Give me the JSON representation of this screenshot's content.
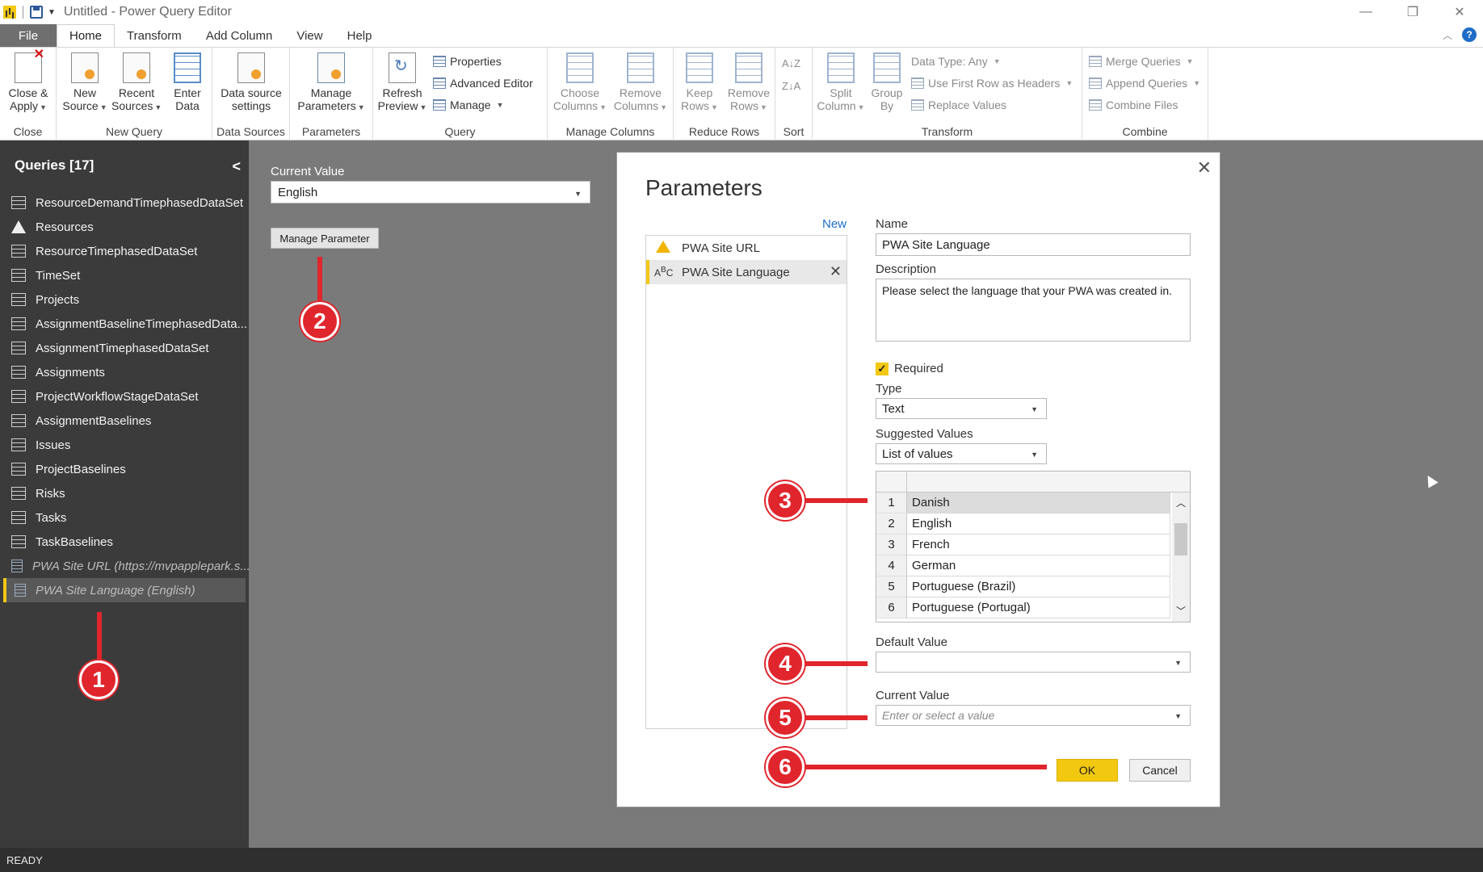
{
  "window": {
    "title": "Untitled - Power Query Editor",
    "controls": [
      "—",
      "❐",
      "✕"
    ]
  },
  "ribbon_tabs": [
    "File",
    "Home",
    "Transform",
    "Add Column",
    "View",
    "Help"
  ],
  "ribbon": {
    "close_group": {
      "label": "Close",
      "close_apply": "Close & Apply"
    },
    "new_query_group": {
      "label": "New Query",
      "new_source": "New Source",
      "recent_sources": "Recent Sources",
      "enter_data": "Enter Data"
    },
    "data_sources_group": {
      "label": "Data Sources",
      "settings": "Data source settings"
    },
    "parameters_group": {
      "label": "Parameters",
      "manage": "Manage Parameters"
    },
    "query_group": {
      "label": "Query",
      "refresh": "Refresh Preview",
      "properties": "Properties",
      "advanced_editor": "Advanced Editor",
      "manage": "Manage"
    },
    "manage_columns_group": {
      "label": "Manage Columns",
      "choose": "Choose Columns",
      "remove": "Remove Columns"
    },
    "reduce_rows_group": {
      "label": "Reduce Rows",
      "keep": "Keep Rows",
      "remove": "Remove Rows"
    },
    "sort_group": {
      "label": "Sort",
      "asc": "A↓Z",
      "desc": "Z↓A"
    },
    "transform_group": {
      "label": "Transform",
      "split": "Split Column",
      "group_by": "Group By",
      "data_type": "Data Type: Any",
      "first_row": "Use First Row as Headers",
      "replace": "Replace Values"
    },
    "combine_group": {
      "label": "Combine",
      "merge": "Merge Queries",
      "append": "Append Queries",
      "combine_files": "Combine Files"
    }
  },
  "queries_panel": {
    "title": "Queries [17]",
    "items": [
      {
        "label": "ResourceDemandTimephasedDataSet",
        "kind": "table"
      },
      {
        "label": "Resources",
        "kind": "warning"
      },
      {
        "label": "ResourceTimephasedDataSet",
        "kind": "table"
      },
      {
        "label": "TimeSet",
        "kind": "table"
      },
      {
        "label": "Projects",
        "kind": "table"
      },
      {
        "label": "AssignmentBaselineTimephasedData...",
        "kind": "table"
      },
      {
        "label": "AssignmentTimephasedDataSet",
        "kind": "table"
      },
      {
        "label": "Assignments",
        "kind": "table"
      },
      {
        "label": "ProjectWorkflowStageDataSet",
        "kind": "table"
      },
      {
        "label": "AssignmentBaselines",
        "kind": "table"
      },
      {
        "label": "Issues",
        "kind": "table"
      },
      {
        "label": "ProjectBaselines",
        "kind": "table"
      },
      {
        "label": "Risks",
        "kind": "table"
      },
      {
        "label": "Tasks",
        "kind": "table"
      },
      {
        "label": "TaskBaselines",
        "kind": "table"
      },
      {
        "label": "PWA Site URL (https://mvpapplepark.s...",
        "kind": "param"
      },
      {
        "label": "PWA Site Language (English)",
        "kind": "param",
        "selected": true
      }
    ]
  },
  "main": {
    "current_value_label": "Current Value",
    "current_value": "English",
    "manage_parameter_button": "Manage Parameter"
  },
  "dialog": {
    "title": "Parameters",
    "new_link": "New",
    "params": [
      {
        "label": "PWA Site URL",
        "icon": "warning-icon"
      },
      {
        "label": "PWA Site Language",
        "icon": "text-type-icon",
        "selected": true
      }
    ],
    "name_label": "Name",
    "name_value": "PWA Site Language",
    "description_label": "Description",
    "description_value": "Please select the language that your PWA was created in.",
    "required_label": "Required",
    "required_checked": true,
    "type_label": "Type",
    "type_value": "Text",
    "suggested_label": "Suggested Values",
    "suggested_value": "List of values",
    "values": [
      {
        "n": "1",
        "v": "Danish"
      },
      {
        "n": "2",
        "v": "English"
      },
      {
        "n": "3",
        "v": "French"
      },
      {
        "n": "4",
        "v": "German"
      },
      {
        "n": "5",
        "v": "Portuguese (Brazil)"
      },
      {
        "n": "6",
        "v": "Portuguese (Portugal)"
      }
    ],
    "default_label": "Default Value",
    "default_value": "",
    "current_label": "Current Value",
    "current_placeholder": "Enter or select a value",
    "ok": "OK",
    "cancel": "Cancel"
  },
  "callouts": [
    "1",
    "2",
    "3",
    "4",
    "5",
    "6"
  ],
  "status": "READY",
  "colors": {
    "accent": "#f2c811",
    "callout": "#e0252d",
    "panel": "#3b3b3b",
    "link": "#1e6ec8"
  }
}
